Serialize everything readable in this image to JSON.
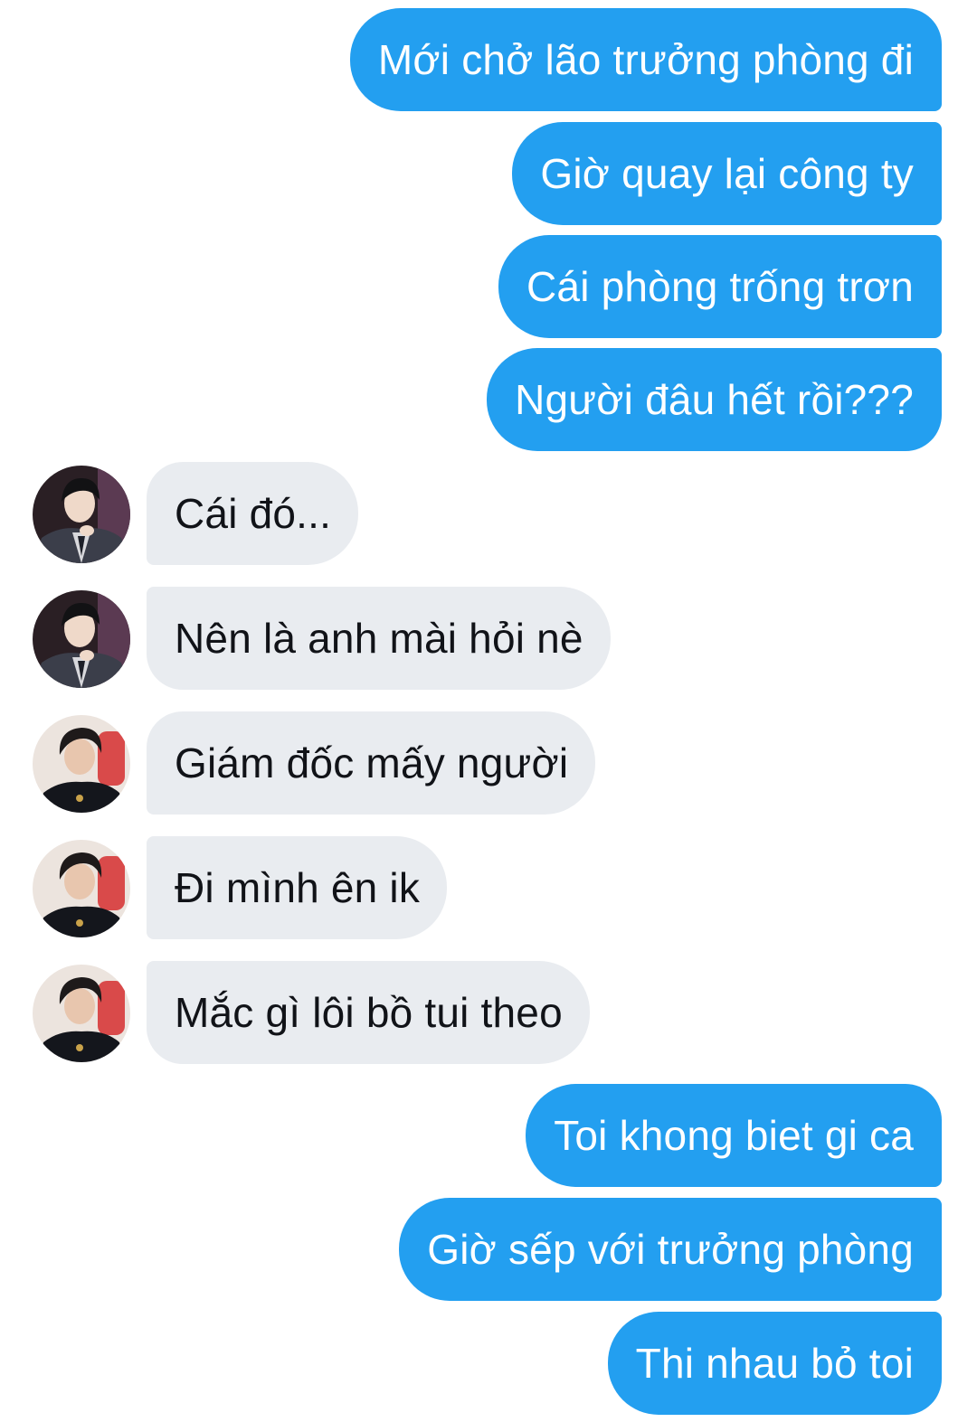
{
  "conversation": {
    "messages": [
      {
        "sender": "me",
        "text": "Mới chở lão trưởng phòng đi"
      },
      {
        "sender": "me",
        "text": "Giờ quay lại công ty"
      },
      {
        "sender": "me",
        "text": "Cái phòng trống trơn"
      },
      {
        "sender": "me",
        "text": "Người đâu hết rồi???"
      },
      {
        "sender": "contact-1",
        "text": "Cái đó..."
      },
      {
        "sender": "contact-1",
        "text": "Nên là anh mài hỏi nè"
      },
      {
        "sender": "contact-2",
        "text": "Giám đốc mấy người"
      },
      {
        "sender": "contact-2",
        "text": "Đi mình ên ik"
      },
      {
        "sender": "contact-2",
        "text": "Mắc gì lôi bồ tui theo"
      },
      {
        "sender": "me",
        "text": "Toi khong biet gi ca"
      },
      {
        "sender": "me",
        "text": "Giờ sếp với trưởng phòng"
      },
      {
        "sender": "me",
        "text": "Thi nhau bỏ toi"
      }
    ]
  },
  "colors": {
    "sent_bubble": "#239ff0",
    "received_bubble": "#e9ecf0",
    "sent_text": "#ffffff",
    "received_text": "#111318"
  },
  "avatars": {
    "contact-1": "dark-suit-profile-photo",
    "contact-2": "black-tshirt-profile-photo"
  }
}
